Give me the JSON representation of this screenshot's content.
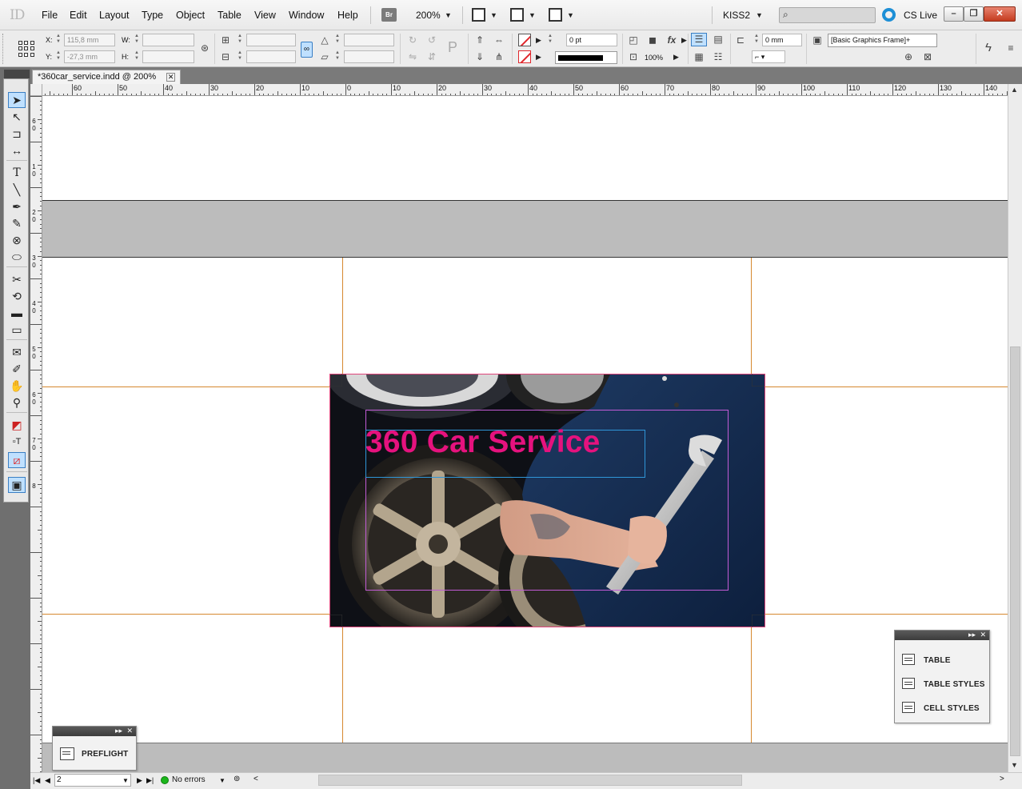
{
  "app": {
    "logo": "ID"
  },
  "menu": [
    "File",
    "Edit",
    "Layout",
    "Type",
    "Object",
    "Table",
    "View",
    "Window",
    "Help"
  ],
  "appbar": {
    "bridge_label": "Br",
    "zoom": "200%",
    "workspace": "KISS2",
    "cs_live": "CS Live"
  },
  "control": {
    "x_label": "X:",
    "x_value": "115,8 mm",
    "y_label": "Y:",
    "y_value": "-27,3 mm",
    "w_label": "W:",
    "h_label": "H:",
    "stroke_weight": "0 pt",
    "opacity": "100%",
    "offset": "0 mm",
    "object_style": "[Basic Graphics Frame]+"
  },
  "document": {
    "tab_title": "*360car_service.indd @ 200%"
  },
  "ruler": {
    "h_labels": [
      "60",
      "50",
      "40",
      "30",
      "20",
      "10",
      "0",
      "10",
      "20",
      "30",
      "40",
      "50",
      "60",
      "70",
      "80",
      "90",
      "100",
      "110",
      "120",
      "130",
      "140"
    ],
    "v_labels": [
      "6",
      "0",
      "1",
      "0",
      "2",
      "0",
      "3",
      "0",
      "4",
      "0",
      "5",
      "0",
      "6",
      "0",
      "7",
      "0",
      "8"
    ]
  },
  "artwork": {
    "headline": "360 Car Service"
  },
  "status": {
    "page": "2",
    "preflight": "No errors"
  },
  "panels": {
    "preflight": {
      "label": "PREFLIGHT"
    },
    "table": {
      "items": [
        "TABLE",
        "TABLE STYLES",
        "CELL STYLES"
      ]
    }
  },
  "colors": {
    "headline": "#e5127e",
    "guide": "#d6882f",
    "accent": "#3a7fc4"
  }
}
